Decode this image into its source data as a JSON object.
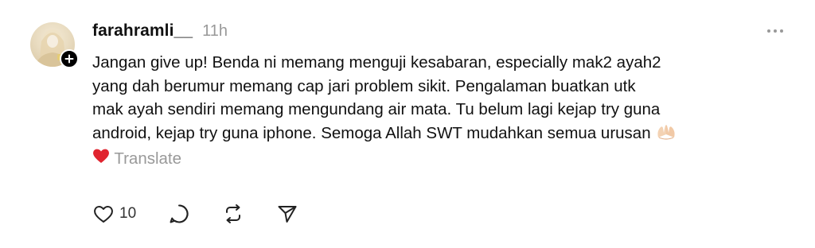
{
  "post": {
    "username": "farahramli__",
    "timestamp": "11h",
    "body_lines": [
      "Jangan give up! Benda ni memang menguji kesabaran, especially mak2 ayah2",
      "yang dah berumur memang cap jari problem sikit. Pengalaman buatkan utk",
      "mak ayah sendiri memang mengundang air mata. Tu belum lagi kejap try guna",
      "android, kejap try guna iphone. Semoga Allah SWT mudahkan semua urusan"
    ],
    "translate_label": "Translate",
    "like_count": "10"
  },
  "icons": {
    "avatar": "profile-photo",
    "follow": "plus-icon",
    "more": "more-horizontal-icon",
    "emoji_1": "praying-hands-emoji",
    "emoji_2": "red-heart-emoji",
    "like": "heart-outline-icon",
    "comment": "speech-bubble-icon",
    "repost": "repost-icon",
    "share": "send-icon"
  },
  "colors": {
    "text": "#111111",
    "muted": "#999999",
    "heart_emoji": "#e0242f",
    "hands_emoji": "#f3d2b3"
  }
}
